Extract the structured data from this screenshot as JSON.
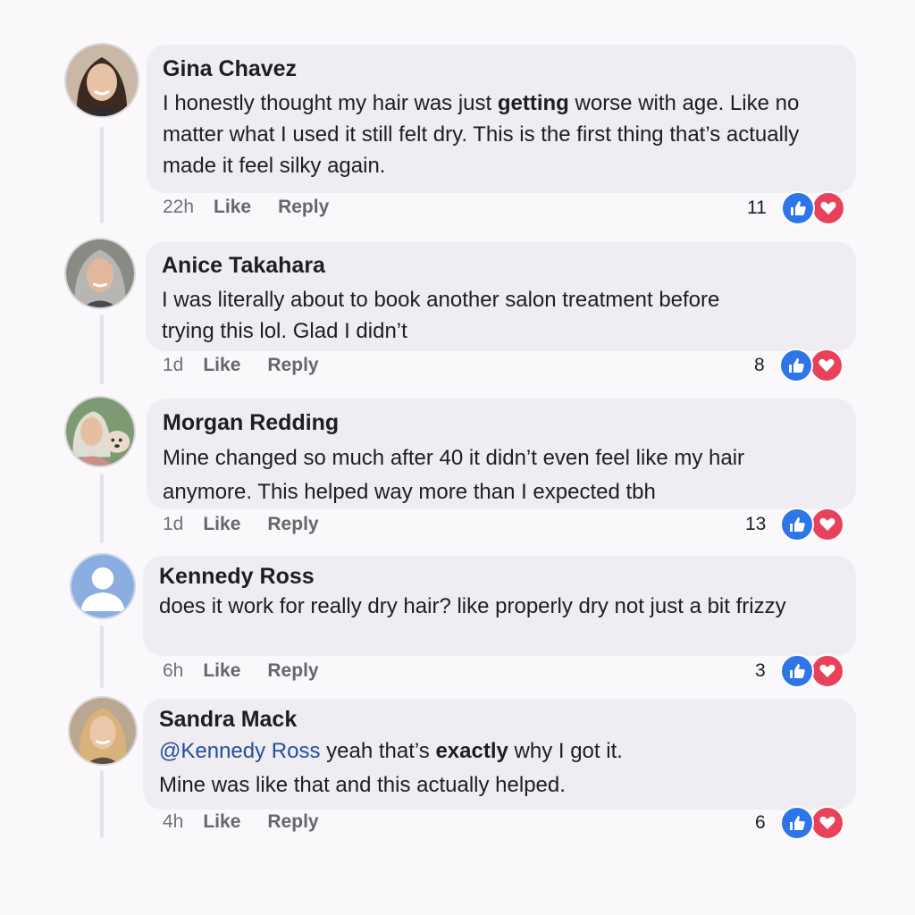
{
  "comments": [
    {
      "author": "Gina Chavez",
      "parts": [
        {
          "text": "I honestly thought my hair was just "
        },
        {
          "text": "getting",
          "style": "bold"
        },
        {
          "text": " worse with age. Like no matter what I used it still felt dry. This is the first thing that’s actually made it feel silky again."
        }
      ],
      "time": "22h",
      "like": "Like",
      "reply": "Reply",
      "count": "11",
      "avatar": "woman-dark-hair"
    },
    {
      "author": "Anice Takahara",
      "parts": [
        {
          "text": "I was literally about to book another salon treatment before trying this lol. Glad I didn’t"
        }
      ],
      "time": "1d",
      "like": "Like",
      "reply": "Reply",
      "count": "8",
      "avatar": "woman-gray-hair"
    },
    {
      "author": "Morgan Redding",
      "parts": [
        {
          "text": "Mine changed so much after 40 it didn’t even feel like my hair anymore. This helped way more than I expected tbh"
        }
      ],
      "time": "1d",
      "like": "Like",
      "reply": "Reply",
      "count": "13",
      "avatar": "woman-with-dog"
    },
    {
      "author": "Kennedy Ross",
      "parts": [
        {
          "text": "does it work for really dry hair? like properly dry not just a bit frizzy"
        }
      ],
      "time": "6h",
      "like": "Like",
      "reply": "Reply",
      "count": "3",
      "avatar": "default-silhouette"
    },
    {
      "author": "Sandra Mack",
      "parts": [
        {
          "text": "@Kennedy Ross",
          "style": "mention"
        },
        {
          "text": " yeah that’s "
        },
        {
          "text": "exactly",
          "style": "bold"
        },
        {
          "text": " why I got it."
        },
        {
          "text": "Mine was like that and this actually helped.",
          "style": "newline"
        }
      ],
      "time": "4h",
      "like": "Like",
      "reply": "Reply",
      "count": "6",
      "avatar": "woman-blonde-hair"
    }
  ],
  "colors": {
    "like": "#2d75e8",
    "love": "#e8425a",
    "mention": "#234f9c",
    "bubble": "#efedf2"
  },
  "icons": [
    "like-icon",
    "love-icon"
  ]
}
